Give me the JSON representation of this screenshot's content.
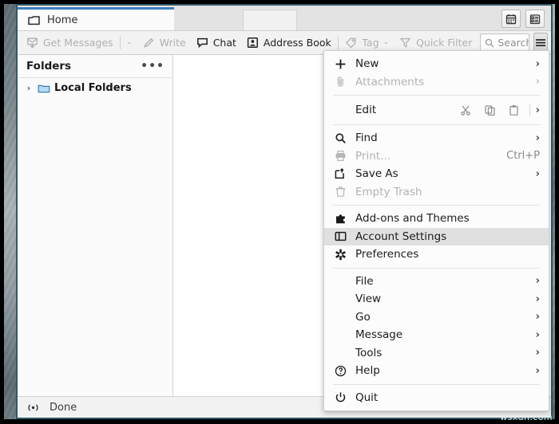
{
  "window": {
    "accent_border_color": "#2e5964",
    "tab_accent_color": "#3a7fc1"
  },
  "tabs": {
    "items": [
      {
        "label": "Home",
        "icon": "folder-icon",
        "active": true
      }
    ],
    "right_buttons": [
      {
        "name": "calendar-button",
        "icon": "calendar-icon"
      },
      {
        "name": "tasks-button",
        "icon": "tasks-icon"
      }
    ]
  },
  "toolbar": {
    "get_messages": {
      "label": "Get Messages",
      "icon": "download-mail-icon",
      "enabled": false
    },
    "get_messages_caret": "⌄",
    "write": {
      "label": "Write",
      "icon": "pencil-icon",
      "enabled": false
    },
    "chat": {
      "label": "Chat",
      "icon": "chat-bubble-icon",
      "enabled": true
    },
    "address_book": {
      "label": "Address Book",
      "icon": "address-book-icon",
      "enabled": true
    },
    "tag": {
      "label": "Tag",
      "icon": "tag-icon",
      "enabled": false
    },
    "tag_caret": "⌄",
    "quick_filter": {
      "label": "Quick Filter",
      "icon": "funnel-icon",
      "enabled": false
    },
    "search": {
      "placeholder": "Search <Ctrl+K>",
      "value": "",
      "icon": "search-icon"
    },
    "app_menu_button": {
      "name": "hamburger-button",
      "icon": "hamburger-icon",
      "pressed": true
    }
  },
  "folder_pane": {
    "header": "Folders",
    "more_button": "•••",
    "tree": [
      {
        "label": "Local Folders",
        "icon": "folder-icon",
        "twisty": "›",
        "expanded": false
      }
    ]
  },
  "status_bar": {
    "icon": "activity-icon",
    "message": "Done"
  },
  "app_menu": {
    "groups": [
      {
        "items": [
          {
            "label": "New",
            "icon": "plus-icon",
            "submenu": true,
            "disabled": false
          },
          {
            "label": "Attachments",
            "icon": "paperclip-icon",
            "submenu": true,
            "disabled": true
          }
        ]
      },
      {
        "type": "edit-row",
        "label": "Edit",
        "buttons": [
          {
            "name": "cut-button",
            "icon": "scissors-icon"
          },
          {
            "name": "copy-button",
            "icon": "copy-icon"
          },
          {
            "name": "paste-button",
            "icon": "clipboard-icon"
          }
        ],
        "submenu": true
      },
      {
        "items": [
          {
            "label": "Find",
            "icon": "search-icon",
            "submenu": true,
            "disabled": false
          },
          {
            "label": "Print…",
            "icon": "printer-icon",
            "accel": "Ctrl+P",
            "submenu": false,
            "disabled": true
          },
          {
            "label": "Save As",
            "icon": "save-as-icon",
            "submenu": true,
            "disabled": false
          },
          {
            "label": "Empty Trash",
            "icon": "trash-icon",
            "submenu": false,
            "disabled": true
          }
        ]
      },
      {
        "items": [
          {
            "label": "Add-ons and Themes",
            "icon": "puzzle-icon",
            "submenu": false,
            "disabled": false
          },
          {
            "label": "Account Settings",
            "icon": "account-panel-icon",
            "submenu": false,
            "disabled": false,
            "highlighted": true
          },
          {
            "label": "Preferences",
            "icon": "gear-icon",
            "submenu": false,
            "disabled": false
          }
        ]
      },
      {
        "items": [
          {
            "label": "File",
            "icon": null,
            "submenu": true,
            "disabled": false
          },
          {
            "label": "View",
            "icon": null,
            "submenu": true,
            "disabled": false
          },
          {
            "label": "Go",
            "icon": null,
            "submenu": true,
            "disabled": false
          },
          {
            "label": "Message",
            "icon": null,
            "submenu": true,
            "disabled": false
          },
          {
            "label": "Tools",
            "icon": null,
            "submenu": true,
            "disabled": false
          },
          {
            "label": "Help",
            "icon": "question-circle-icon",
            "submenu": true,
            "disabled": false
          }
        ]
      },
      {
        "items": [
          {
            "label": "Quit",
            "icon": "power-icon",
            "submenu": false,
            "disabled": false
          }
        ]
      }
    ],
    "chevron_glyph": "›"
  },
  "watermark": "wsxdn.com"
}
